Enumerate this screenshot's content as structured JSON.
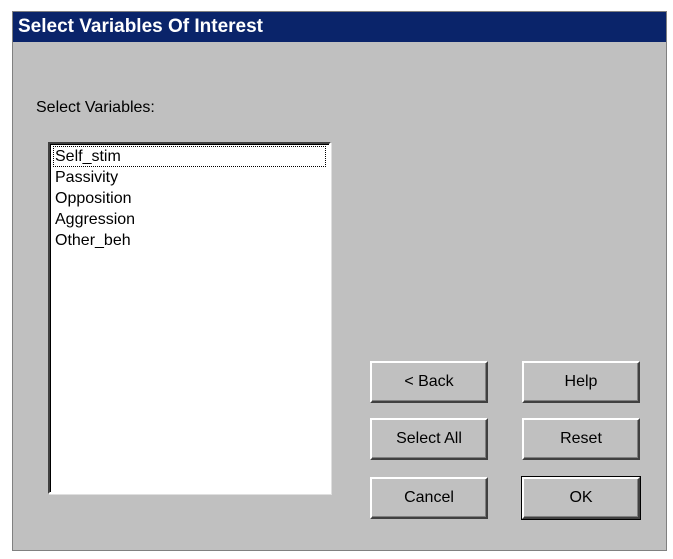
{
  "window": {
    "title": "Select Variables Of Interest"
  },
  "label": "Select Variables:",
  "variables": [
    "Self_stim",
    "Passivity",
    "Opposition",
    "Aggression",
    "Other_beh"
  ],
  "buttons": {
    "back": "< Back",
    "help": "Help",
    "select_all": "Select All",
    "reset": "Reset",
    "cancel": "Cancel",
    "ok": "OK"
  },
  "colors": {
    "title_bar": "#0a246a",
    "dialog_face": "#c0c0c0"
  }
}
